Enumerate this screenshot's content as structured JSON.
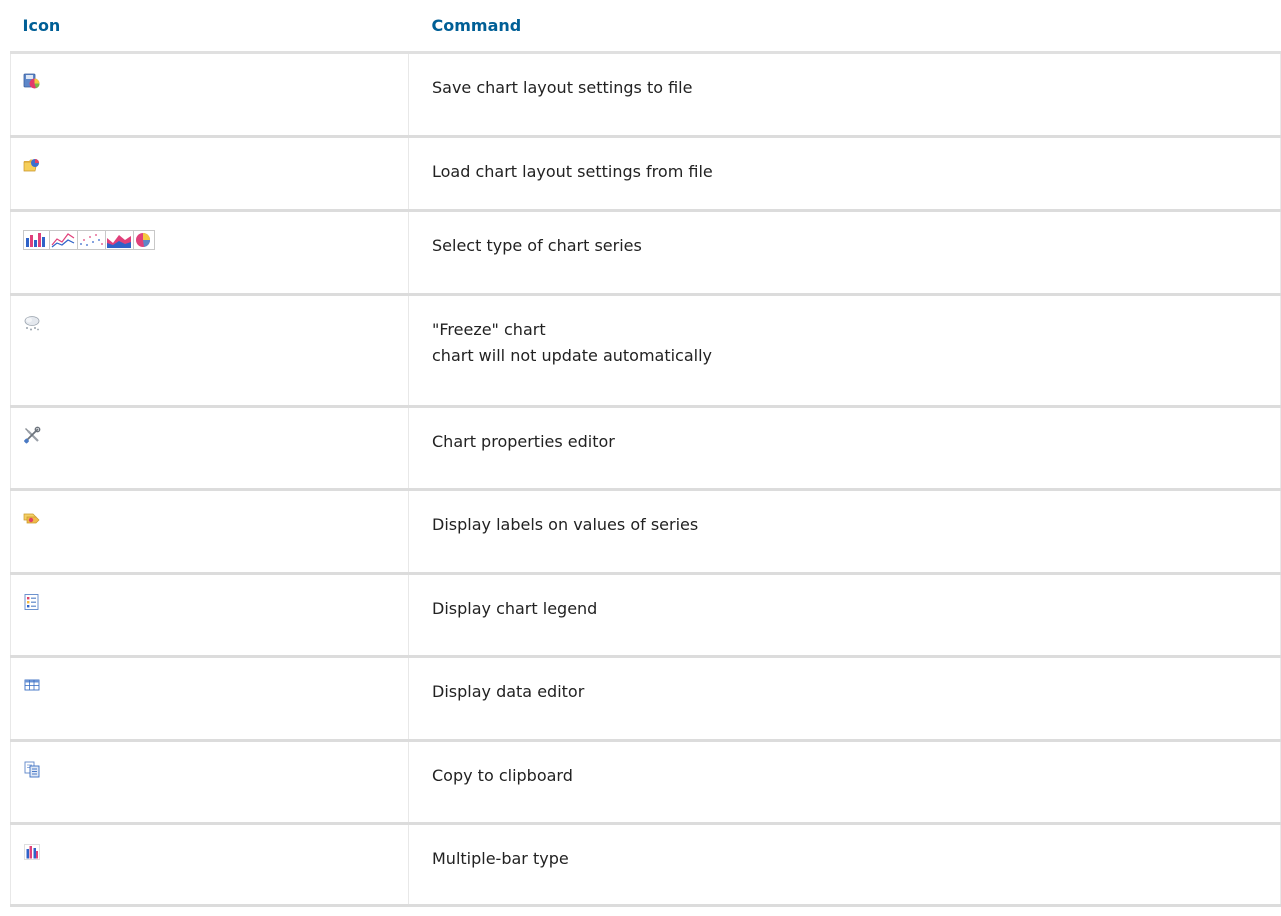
{
  "table": {
    "headers": {
      "icon": "Icon",
      "command": "Command"
    },
    "rows": [
      {
        "icon": "save-chart-layout-icon",
        "lines": [
          "Save chart layout settings to file"
        ]
      },
      {
        "icon": "open-folder-icon",
        "lines": [
          "Load chart layout settings from file"
        ]
      },
      {
        "icon": "chart-series-types-icon",
        "lines": [
          "Select type of chart series"
        ]
      },
      {
        "icon": "freeze-snowflake-icon",
        "lines": [
          "\"Freeze\" chart",
          "chart will not update automatically"
        ]
      },
      {
        "icon": "properties-tools-icon",
        "lines": [
          "Chart properties editor"
        ]
      },
      {
        "icon": "labels-icon",
        "lines": [
          "Display labels on values of series"
        ]
      },
      {
        "icon": "legend-icon",
        "lines": [
          "Display chart legend"
        ]
      },
      {
        "icon": "data-grid-icon",
        "lines": [
          "Display data editor"
        ]
      },
      {
        "icon": "copy-clipboard-icon",
        "lines": [
          "Copy to clipboard"
        ]
      },
      {
        "icon": "multiple-bar-icon",
        "lines": [
          "Multiple-bar type"
        ]
      }
    ]
  },
  "colors": {
    "header_text": "#005f96",
    "row_divider": "#dcdcdc",
    "body_text": "#222222"
  }
}
